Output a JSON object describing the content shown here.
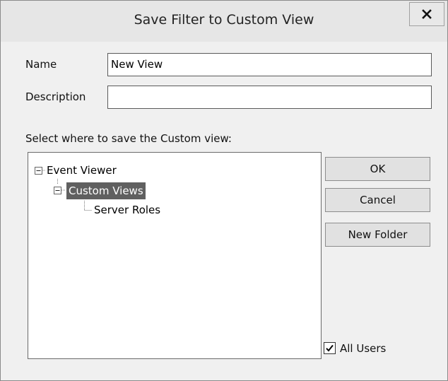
{
  "dialog": {
    "title": "Save Filter to Custom View",
    "close_icon": "close-icon"
  },
  "form": {
    "name_label": "Name",
    "name_value": "New View",
    "description_label": "Description",
    "description_value": "",
    "location_prompt": "Select where to save the Custom view:"
  },
  "tree": {
    "root": {
      "label": "Event Viewer",
      "expanded": true
    },
    "child": {
      "label": "Custom Views",
      "expanded": true,
      "selected": true
    },
    "grandchild": {
      "label": "Server Roles"
    },
    "selection_color": "#606060"
  },
  "buttons": {
    "ok": "OK",
    "cancel": "Cancel",
    "new_folder": "New Folder"
  },
  "all_users": {
    "label": "All Users",
    "checked": true
  }
}
